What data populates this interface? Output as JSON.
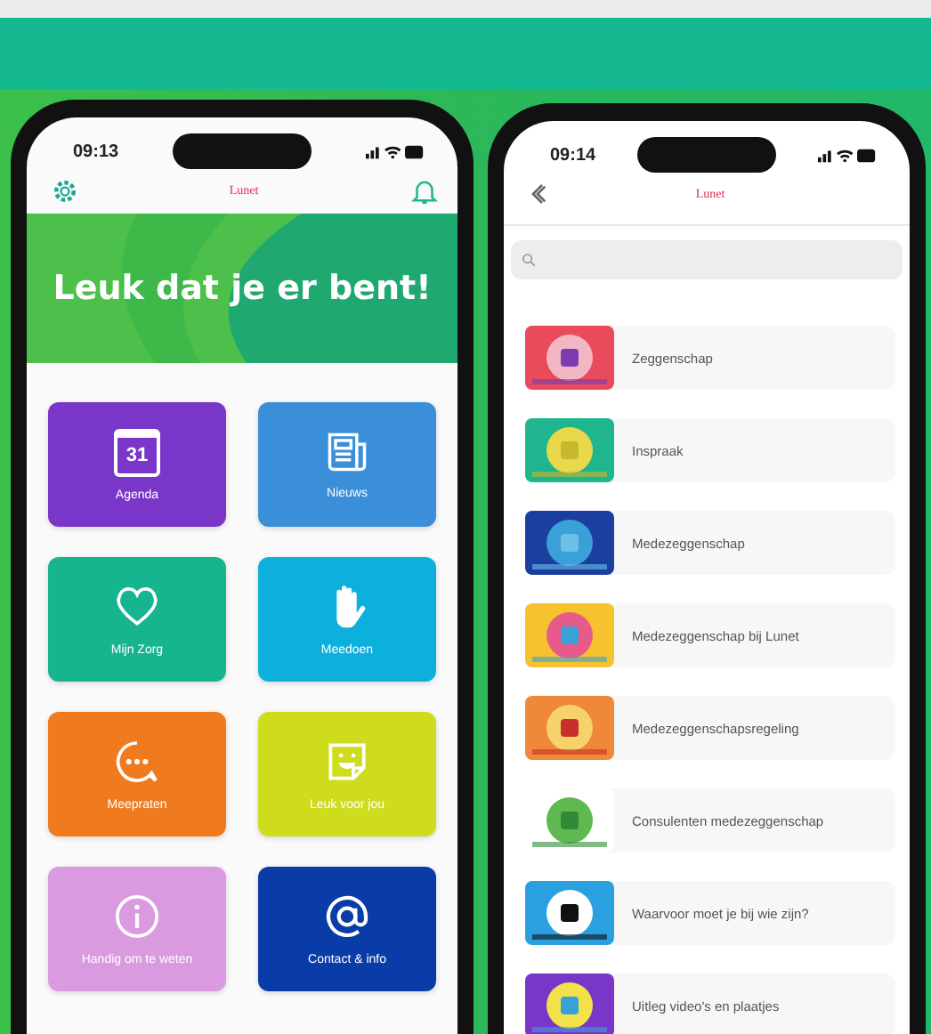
{
  "home_phone": {
    "time": "09:13",
    "logo": "Lunet",
    "banner": "Leuk dat je er bent!",
    "tiles": [
      {
        "label": "Agenda",
        "icon_text": "31",
        "color": "#7a36c8"
      },
      {
        "label": "Nieuws",
        "color": "#3a8fd8"
      },
      {
        "label": "Mijn Zorg",
        "color": "#17b58f"
      },
      {
        "label": "Meedoen",
        "color": "#0db0dc"
      },
      {
        "label": "Meepraten",
        "color": "#f07a1e"
      },
      {
        "label": "Leuk voor jou",
        "color": "#cfdc1e"
      },
      {
        "label": "Handig om te weten",
        "color": "#d99ae0"
      },
      {
        "label": "Contact & info",
        "color": "#0a3ca8"
      }
    ]
  },
  "list_phone": {
    "time": "09:14",
    "logo": "Lunet",
    "items": [
      {
        "label": "Zeggenschap"
      },
      {
        "label": "Inspraak"
      },
      {
        "label": "Medezeggenschap"
      },
      {
        "label": "Medezeggenschap bij Lunet"
      },
      {
        "label": "Medezeggenschapsregeling"
      },
      {
        "label": "Consulenten medezeggenschap"
      },
      {
        "label": "Waarvoor moet je bij wie zijn?"
      },
      {
        "label": "Uitleg video's en plaatjes"
      }
    ]
  }
}
